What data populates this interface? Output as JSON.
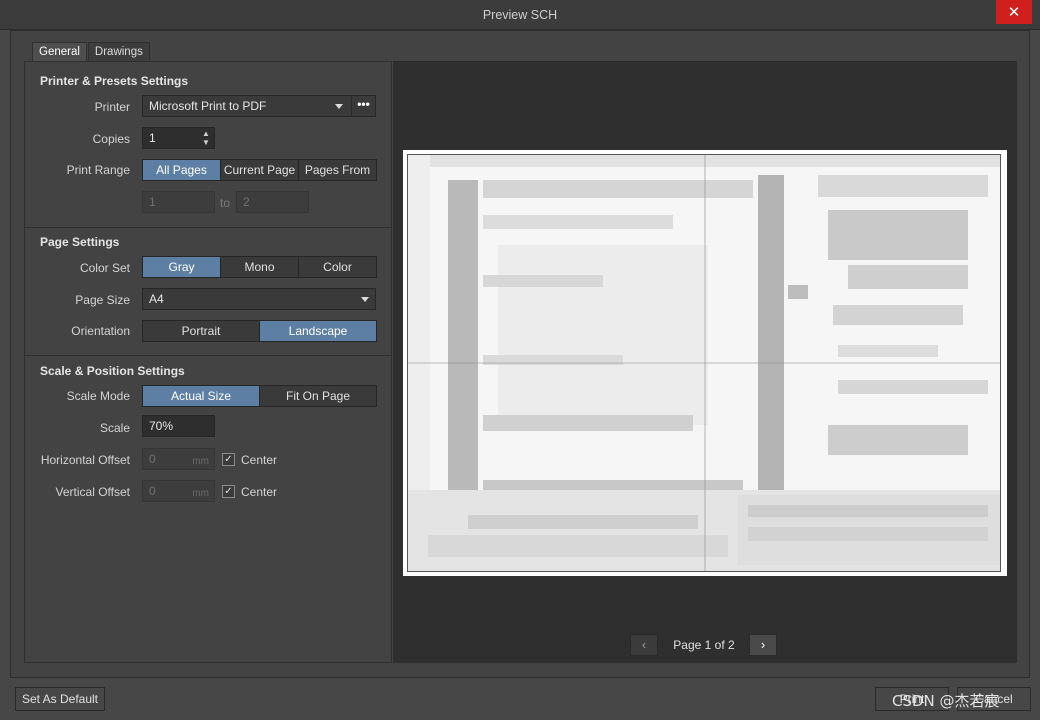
{
  "window": {
    "title": "Preview SCH",
    "close_glyph": "✕"
  },
  "tabs": [
    {
      "label": "General"
    },
    {
      "label": "Drawings"
    }
  ],
  "printer_section": {
    "title": "Printer & Presets Settings",
    "printer_label": "Printer",
    "printer_value": "Microsoft Print to PDF",
    "more_glyph": "•••",
    "copies_label": "Copies",
    "copies_value": "1",
    "print_range_label": "Print Range",
    "print_range_options": [
      "All Pages",
      "Current Page",
      "Pages From"
    ],
    "print_range_selected": "All Pages",
    "from_value": "1",
    "to_label": "to",
    "to_value": "2"
  },
  "page_section": {
    "title": "Page Settings",
    "color_set_label": "Color Set",
    "color_set_options": [
      "Gray",
      "Mono",
      "Color"
    ],
    "color_set_selected": "Gray",
    "page_size_label": "Page Size",
    "page_size_value": "A4",
    "orientation_label": "Orientation",
    "orientation_options": [
      "Portrait",
      "Landscape"
    ],
    "orientation_selected": "Landscape"
  },
  "scale_section": {
    "title": "Scale & Position Settings",
    "scale_mode_label": "Scale Mode",
    "scale_mode_options": [
      "Actual Size",
      "Fit On Page"
    ],
    "scale_mode_selected": "Actual Size",
    "scale_label": "Scale",
    "scale_value": "70%",
    "h_offset_label": "Horizontal Offset",
    "h_offset_value": "0",
    "h_offset_unit": "mm",
    "h_center_label": "Center",
    "h_center_checked": true,
    "v_offset_label": "Vertical Offset",
    "v_offset_value": "0",
    "v_offset_unit": "mm",
    "v_center_label": "Center",
    "v_center_checked": true,
    "check_glyph": "✓"
  },
  "preview": {
    "page_text": "Page 1 of 2",
    "prev_glyph": "‹",
    "next_glyph": "›"
  },
  "footer": {
    "set_default_label": "Set As Default",
    "print_label": "Print",
    "cancel_label": "Cancel",
    "watermark": "CSDN @杰若宸"
  },
  "colors": {
    "accent": "#5d7fa3",
    "close": "#d11f1f"
  }
}
